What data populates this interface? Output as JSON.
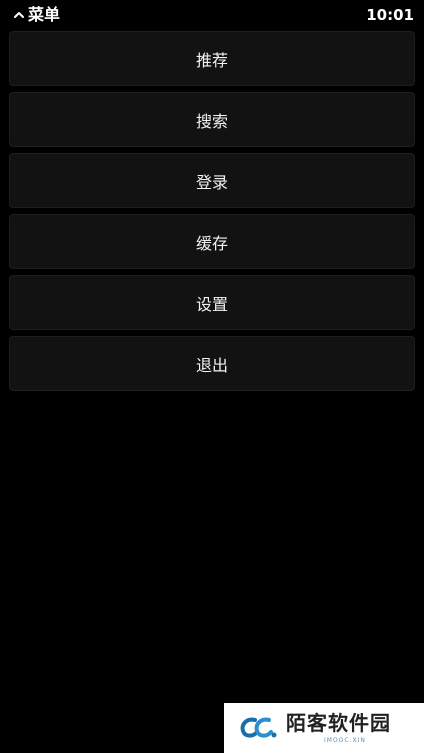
{
  "header": {
    "back_icon": "chevron-up-icon",
    "title": "菜单",
    "time": "10:01"
  },
  "menu": {
    "items": [
      {
        "label": "推荐"
      },
      {
        "label": "搜索"
      },
      {
        "label": "登录"
      },
      {
        "label": "缓存"
      },
      {
        "label": "设置"
      },
      {
        "label": "退出"
      }
    ]
  },
  "watermark": {
    "name": "陌客软件园",
    "domain": "IMOOC.XIN"
  },
  "colors": {
    "background": "#000000",
    "item_background": "#121212",
    "text": "#ffffff",
    "watermark_accent": "#1a6fa8"
  }
}
